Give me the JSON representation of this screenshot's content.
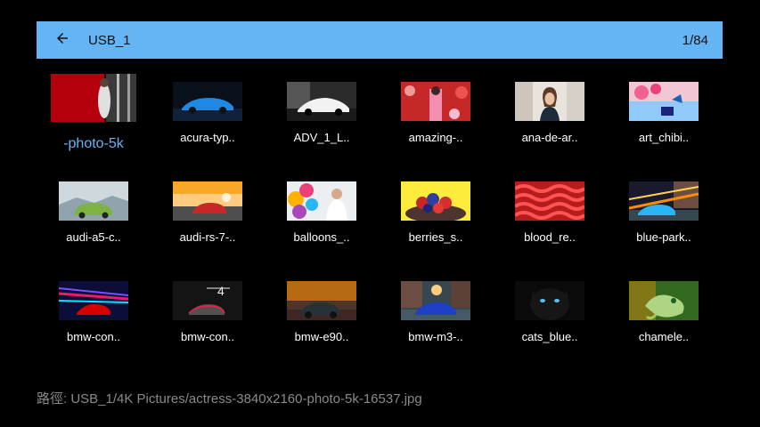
{
  "header": {
    "title": "USB_1",
    "count": "1/84"
  },
  "colors": {
    "header_bg": "#64b5f6",
    "focus_text": "#64b5f6",
    "background": "#000000",
    "path_text": "#8a8a8a"
  },
  "icons": {
    "back": "arrow-left-icon"
  },
  "files": [
    {
      "label": "-photo-5k",
      "focused": true
    },
    {
      "label": "acura-typ.."
    },
    {
      "label": "ADV_1_L.."
    },
    {
      "label": "amazing-.."
    },
    {
      "label": "ana-de-ar.."
    },
    {
      "label": "art_chibi.."
    },
    {
      "label": "audi-a5-c.."
    },
    {
      "label": "audi-rs-7-.."
    },
    {
      "label": "balloons_.."
    },
    {
      "label": "berries_s.."
    },
    {
      "label": "blood_re.."
    },
    {
      "label": "blue-park.."
    },
    {
      "label": "bmw-con.."
    },
    {
      "label": "bmw-con.."
    },
    {
      "label": "bmw-e90.."
    },
    {
      "label": "bmw-m3-.."
    },
    {
      "label": "cats_blue.."
    },
    {
      "label": "chamele.."
    }
  ],
  "path": "路徑: USB_1/4K Pictures/actress-3840x2160-photo-5k-16537.jpg"
}
